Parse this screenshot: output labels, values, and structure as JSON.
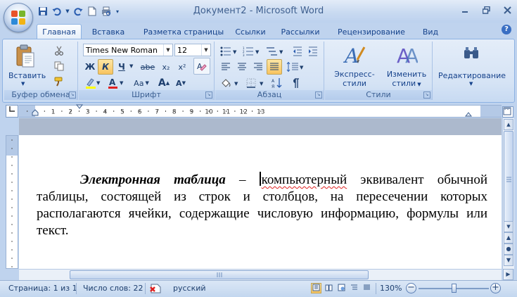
{
  "window": {
    "title": "Документ2 - Microsoft Word"
  },
  "quick_access": {
    "icons": [
      "save-icon",
      "undo-icon",
      "redo-icon",
      "new-document-icon",
      "print-preview-icon",
      "customize-icon"
    ]
  },
  "ribbon_tabs": [
    {
      "label": "Главная",
      "active": true
    },
    {
      "label": "Вставка"
    },
    {
      "label": "Разметка страницы"
    },
    {
      "label": "Ссылки"
    },
    {
      "label": "Рассылки"
    },
    {
      "label": "Рецензирование"
    },
    {
      "label": "Вид"
    }
  ],
  "clipboard_group": {
    "paste_label": "Вставить",
    "group_label": "Буфер обмена"
  },
  "font_group": {
    "font_name": "Times New Roman",
    "font_size": "12",
    "bold": "Ж",
    "italic": "К",
    "underline": "Ч",
    "strikethrough": "abe",
    "subscript": "x₂",
    "superscript": "x²",
    "change_case": "Aa",
    "grow_font": "A",
    "shrink_font": "A",
    "group_label": "Шрифт"
  },
  "paragraph_group": {
    "group_label": "Абзац"
  },
  "styles_group": {
    "quick_styles_label": "Экспресс-стили",
    "change_styles_label_1": "Изменить",
    "change_styles_label_2": "стили",
    "group_label": "Стили"
  },
  "editing_group": {
    "label": "Редактирование"
  },
  "ruler": {
    "labels": [
      "2",
      "1",
      "1",
      "2",
      "3",
      "4",
      "5",
      "6",
      "7",
      "8",
      "9",
      "10",
      "11",
      "12",
      "13"
    ]
  },
  "document": {
    "term": "Электронная таблица",
    "dash": " – ",
    "misspelled": "компьютерный",
    "rest": " эквивалент обычной таблицы, состоящей из строк и столбцов, на пересечении которых располагаются ячейки, содержащие числовую информацию, формулы или текст."
  },
  "status_bar": {
    "page": "Страница: 1 из 1",
    "words": "Число слов: 22",
    "language": "русский",
    "zoom": "130%",
    "zoom_level_percent": 130
  }
}
